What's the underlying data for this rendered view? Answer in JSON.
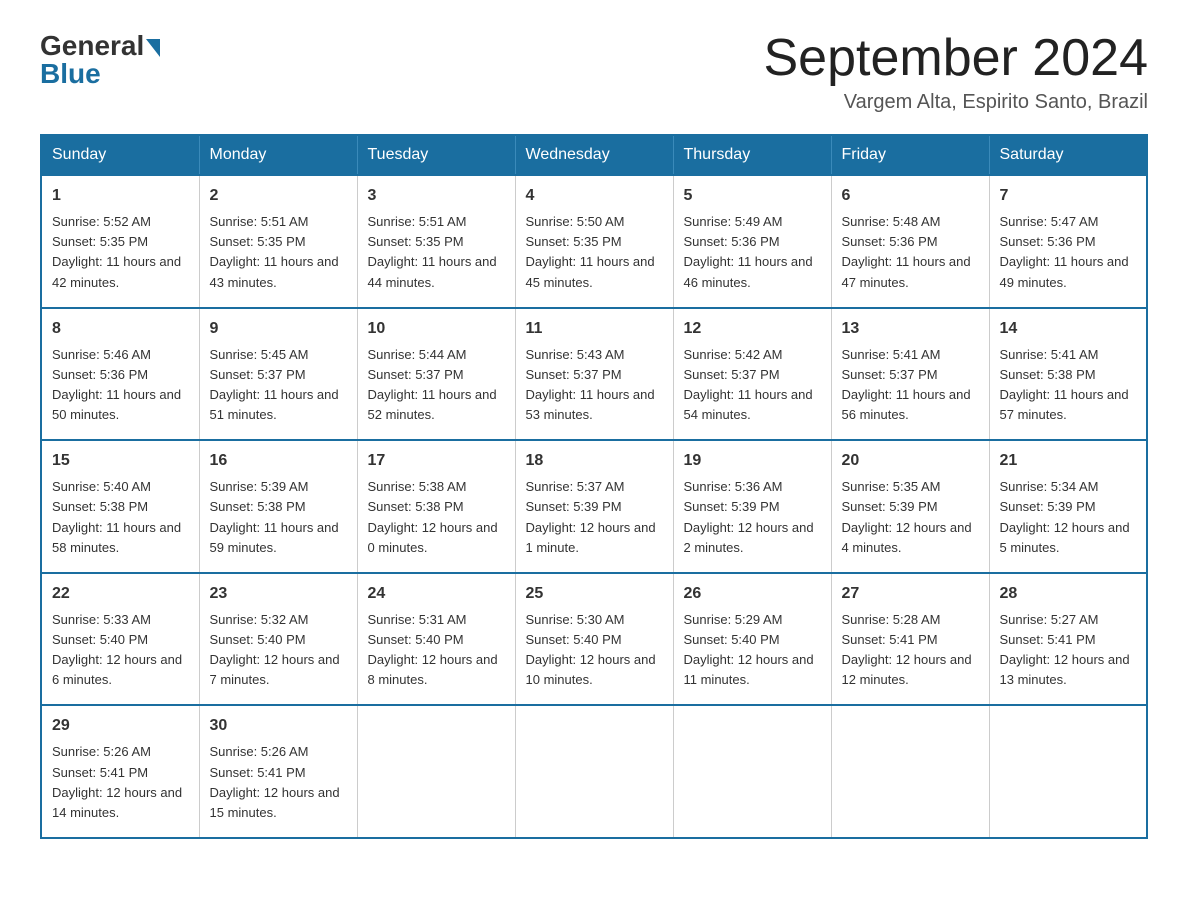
{
  "header": {
    "logo_general": "General",
    "logo_blue": "Blue",
    "month_title": "September 2024",
    "location": "Vargem Alta, Espirito Santo, Brazil"
  },
  "weekdays": [
    "Sunday",
    "Monday",
    "Tuesday",
    "Wednesday",
    "Thursday",
    "Friday",
    "Saturday"
  ],
  "weeks": [
    [
      {
        "day": "1",
        "sunrise": "5:52 AM",
        "sunset": "5:35 PM",
        "daylight": "11 hours and 42 minutes."
      },
      {
        "day": "2",
        "sunrise": "5:51 AM",
        "sunset": "5:35 PM",
        "daylight": "11 hours and 43 minutes."
      },
      {
        "day": "3",
        "sunrise": "5:51 AM",
        "sunset": "5:35 PM",
        "daylight": "11 hours and 44 minutes."
      },
      {
        "day": "4",
        "sunrise": "5:50 AM",
        "sunset": "5:35 PM",
        "daylight": "11 hours and 45 minutes."
      },
      {
        "day": "5",
        "sunrise": "5:49 AM",
        "sunset": "5:36 PM",
        "daylight": "11 hours and 46 minutes."
      },
      {
        "day": "6",
        "sunrise": "5:48 AM",
        "sunset": "5:36 PM",
        "daylight": "11 hours and 47 minutes."
      },
      {
        "day": "7",
        "sunrise": "5:47 AM",
        "sunset": "5:36 PM",
        "daylight": "11 hours and 49 minutes."
      }
    ],
    [
      {
        "day": "8",
        "sunrise": "5:46 AM",
        "sunset": "5:36 PM",
        "daylight": "11 hours and 50 minutes."
      },
      {
        "day": "9",
        "sunrise": "5:45 AM",
        "sunset": "5:37 PM",
        "daylight": "11 hours and 51 minutes."
      },
      {
        "day": "10",
        "sunrise": "5:44 AM",
        "sunset": "5:37 PM",
        "daylight": "11 hours and 52 minutes."
      },
      {
        "day": "11",
        "sunrise": "5:43 AM",
        "sunset": "5:37 PM",
        "daylight": "11 hours and 53 minutes."
      },
      {
        "day": "12",
        "sunrise": "5:42 AM",
        "sunset": "5:37 PM",
        "daylight": "11 hours and 54 minutes."
      },
      {
        "day": "13",
        "sunrise": "5:41 AM",
        "sunset": "5:37 PM",
        "daylight": "11 hours and 56 minutes."
      },
      {
        "day": "14",
        "sunrise": "5:41 AM",
        "sunset": "5:38 PM",
        "daylight": "11 hours and 57 minutes."
      }
    ],
    [
      {
        "day": "15",
        "sunrise": "5:40 AM",
        "sunset": "5:38 PM",
        "daylight": "11 hours and 58 minutes."
      },
      {
        "day": "16",
        "sunrise": "5:39 AM",
        "sunset": "5:38 PM",
        "daylight": "11 hours and 59 minutes."
      },
      {
        "day": "17",
        "sunrise": "5:38 AM",
        "sunset": "5:38 PM",
        "daylight": "12 hours and 0 minutes."
      },
      {
        "day": "18",
        "sunrise": "5:37 AM",
        "sunset": "5:39 PM",
        "daylight": "12 hours and 1 minute."
      },
      {
        "day": "19",
        "sunrise": "5:36 AM",
        "sunset": "5:39 PM",
        "daylight": "12 hours and 2 minutes."
      },
      {
        "day": "20",
        "sunrise": "5:35 AM",
        "sunset": "5:39 PM",
        "daylight": "12 hours and 4 minutes."
      },
      {
        "day": "21",
        "sunrise": "5:34 AM",
        "sunset": "5:39 PM",
        "daylight": "12 hours and 5 minutes."
      }
    ],
    [
      {
        "day": "22",
        "sunrise": "5:33 AM",
        "sunset": "5:40 PM",
        "daylight": "12 hours and 6 minutes."
      },
      {
        "day": "23",
        "sunrise": "5:32 AM",
        "sunset": "5:40 PM",
        "daylight": "12 hours and 7 minutes."
      },
      {
        "day": "24",
        "sunrise": "5:31 AM",
        "sunset": "5:40 PM",
        "daylight": "12 hours and 8 minutes."
      },
      {
        "day": "25",
        "sunrise": "5:30 AM",
        "sunset": "5:40 PM",
        "daylight": "12 hours and 10 minutes."
      },
      {
        "day": "26",
        "sunrise": "5:29 AM",
        "sunset": "5:40 PM",
        "daylight": "12 hours and 11 minutes."
      },
      {
        "day": "27",
        "sunrise": "5:28 AM",
        "sunset": "5:41 PM",
        "daylight": "12 hours and 12 minutes."
      },
      {
        "day": "28",
        "sunrise": "5:27 AM",
        "sunset": "5:41 PM",
        "daylight": "12 hours and 13 minutes."
      }
    ],
    [
      {
        "day": "29",
        "sunrise": "5:26 AM",
        "sunset": "5:41 PM",
        "daylight": "12 hours and 14 minutes."
      },
      {
        "day": "30",
        "sunrise": "5:26 AM",
        "sunset": "5:41 PM",
        "daylight": "12 hours and 15 minutes."
      },
      null,
      null,
      null,
      null,
      null
    ]
  ],
  "labels": {
    "sunrise_prefix": "Sunrise: ",
    "sunset_prefix": "Sunset: ",
    "daylight_prefix": "Daylight: "
  }
}
